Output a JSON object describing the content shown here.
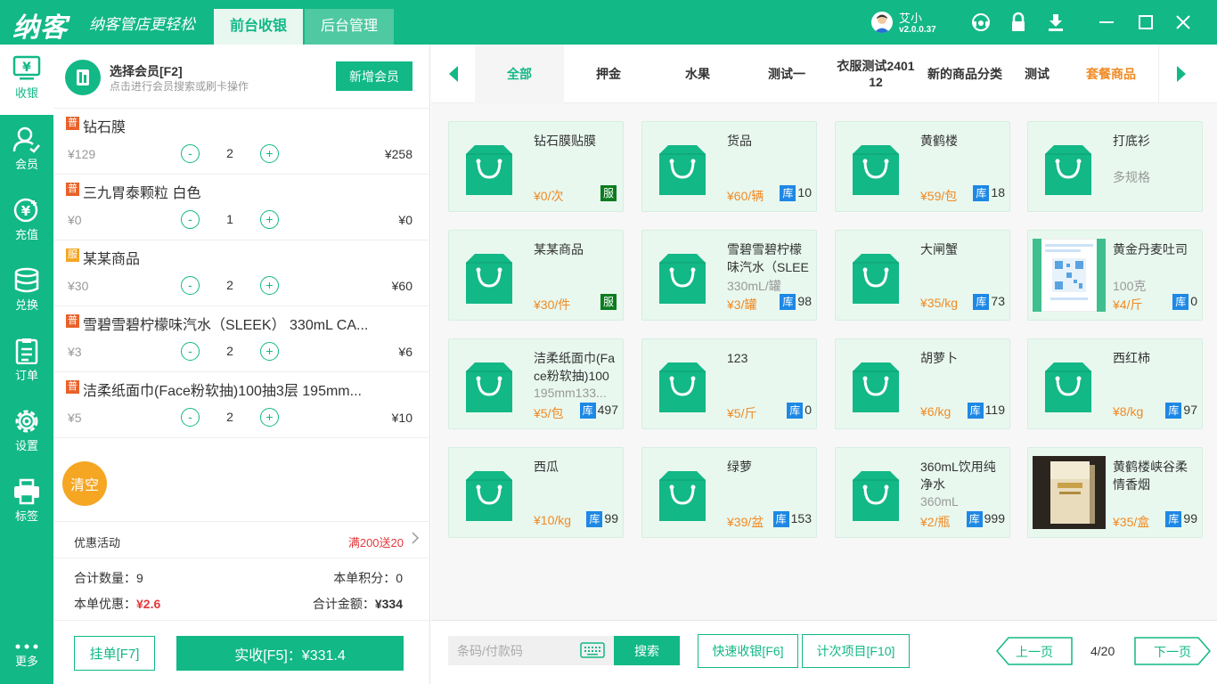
{
  "app": {
    "logo": "纳客",
    "slogan": "纳客管店更轻松"
  },
  "top_tabs": [
    {
      "label": "前台收银",
      "active": true
    },
    {
      "label": "后台管理",
      "active": false
    }
  ],
  "user": {
    "name": "艾小",
    "version": "v2.0.0.37"
  },
  "window_icons": [
    "headset-icon",
    "lock-icon",
    "download-icon",
    "minimize-icon",
    "maximize-icon",
    "close-icon"
  ],
  "sidebar": {
    "items": [
      {
        "label": "收银",
        "icon": "cashier-icon",
        "active": true
      },
      {
        "label": "会员",
        "icon": "member-icon"
      },
      {
        "label": "充值",
        "icon": "recharge-icon"
      },
      {
        "label": "兑换",
        "icon": "exchange-icon"
      },
      {
        "label": "订单",
        "icon": "order-icon"
      },
      {
        "label": "设置",
        "icon": "settings-icon"
      },
      {
        "label": "标签",
        "icon": "printer-icon"
      }
    ],
    "more_label": "更多"
  },
  "member": {
    "title": "选择会员[F2]",
    "desc": "点击进行会员搜索或刷卡操作",
    "new_button": "新增会员"
  },
  "cart": {
    "minus": "-",
    "plus": "+",
    "items": [
      {
        "tag": "普",
        "tag_color": "#e8622a",
        "name": "钻石膜",
        "unit_price": "¥129",
        "qty": "2",
        "total": "¥258"
      },
      {
        "tag": "普",
        "tag_color": "#e8622a",
        "name": "三九胃泰颗粒 白色",
        "unit_price": "¥0",
        "qty": "1",
        "total": "¥0"
      },
      {
        "tag": "服",
        "tag_color": "#f5a623",
        "name": "某某商品",
        "unit_price": "¥30",
        "qty": "2",
        "total": "¥60"
      },
      {
        "tag": "普",
        "tag_color": "#e8622a",
        "name": "雪碧雪碧柠檬味汽水（SLEEK） 330mL CA...",
        "unit_price": "¥3",
        "qty": "2",
        "total": "¥6"
      },
      {
        "tag": "普",
        "tag_color": "#e8622a",
        "name": "洁柔纸面巾(Face粉软抽)100抽3层 195mm...",
        "unit_price": "¥5",
        "qty": "2",
        "total": "¥10"
      }
    ],
    "clear_label": "清空"
  },
  "promo": {
    "label": "优惠活动",
    "value": "满200送20"
  },
  "summary": {
    "qty_label": "合计数量：",
    "qty_value": "9",
    "points_label": "本单积分：",
    "points_value": "0",
    "discount_label": "本单优惠：",
    "discount_value": "¥2.6",
    "total_label": "合计金额：",
    "total_value": "¥334"
  },
  "actions": {
    "hold": "挂单[F7]",
    "pay": "实收[F5]：¥331.4"
  },
  "categories": [
    {
      "label": "全部",
      "active": true
    },
    {
      "label": "押金"
    },
    {
      "label": "水果"
    },
    {
      "label": "测试一"
    },
    {
      "label": "衣服测试240112"
    },
    {
      "label": "新的商品分类"
    },
    {
      "label": "测试"
    },
    {
      "label": "套餐商品",
      "orange": true
    }
  ],
  "stock_tag": "库",
  "service_tag": "服",
  "products": [
    {
      "name": "钻石膜贴膜",
      "spec": "",
      "price": "¥0/次",
      "stock": "",
      "service": true,
      "image": "bag"
    },
    {
      "name": "货品",
      "spec": "",
      "price": "¥60/辆",
      "stock": "10",
      "image": "bag"
    },
    {
      "name": "黄鹤楼",
      "spec": "",
      "price": "¥59/包",
      "stock": "18",
      "image": "bag"
    },
    {
      "name": "打底衫",
      "spec": "多规格",
      "price": "",
      "stock": "",
      "image": "bag"
    },
    {
      "name": "某某商品",
      "spec": "",
      "price": "¥30/件",
      "stock": "",
      "service": true,
      "image": "bag"
    },
    {
      "name": "雪碧雪碧柠檬味汽水（SLEE",
      "spec": "330mL/罐",
      "price": "¥3/罐",
      "stock": "98",
      "image": "bag"
    },
    {
      "name": "大闸蟹",
      "spec": "",
      "price": "¥35/kg",
      "stock": "73",
      "image": "bag"
    },
    {
      "name": "黄金丹麦吐司",
      "spec": "100克",
      "price": "¥4/斤",
      "stock": "0",
      "image": "qr-card"
    },
    {
      "name": "洁柔纸面巾(Face粉软抽)100",
      "spec": "195mm133...",
      "price": "¥5/包",
      "stock": "497",
      "image": "bag"
    },
    {
      "name": "123",
      "spec": "",
      "price": "¥5/斤",
      "stock": "0",
      "image": "bag"
    },
    {
      "name": "胡萝卜",
      "spec": "",
      "price": "¥6/kg",
      "stock": "119",
      "image": "bag"
    },
    {
      "name": "西红柿",
      "spec": "",
      "price": "¥8/kg",
      "stock": "97",
      "image": "bag"
    },
    {
      "name": "西瓜",
      "spec": "",
      "price": "¥10/kg",
      "stock": "99",
      "image": "bag"
    },
    {
      "name": "绿萝",
      "spec": "",
      "price": "¥39/盆",
      "stock": "153",
      "image": "bag"
    },
    {
      "name": "360mL饮用纯净水",
      "spec": "360mL",
      "price": "¥2/瓶",
      "stock": "999",
      "image": "bag"
    },
    {
      "name": "黄鹤楼峡谷柔情香烟",
      "spec": "",
      "price": "¥35/盒",
      "stock": "99",
      "image": "cigarette-photo"
    }
  ],
  "search": {
    "placeholder": "条码/付款码",
    "button": "搜索"
  },
  "quick": {
    "fast": "快速收银[F6]",
    "count": "计次项目[F10]"
  },
  "pager": {
    "prev": "上一页",
    "page": "4/20",
    "next": "下一页"
  },
  "colors": {
    "brand": "#12b886",
    "price": "#f08a24",
    "danger": "#e4393c",
    "stock_tag": "#1e88e5",
    "service_tag": "#0a7c1f"
  }
}
